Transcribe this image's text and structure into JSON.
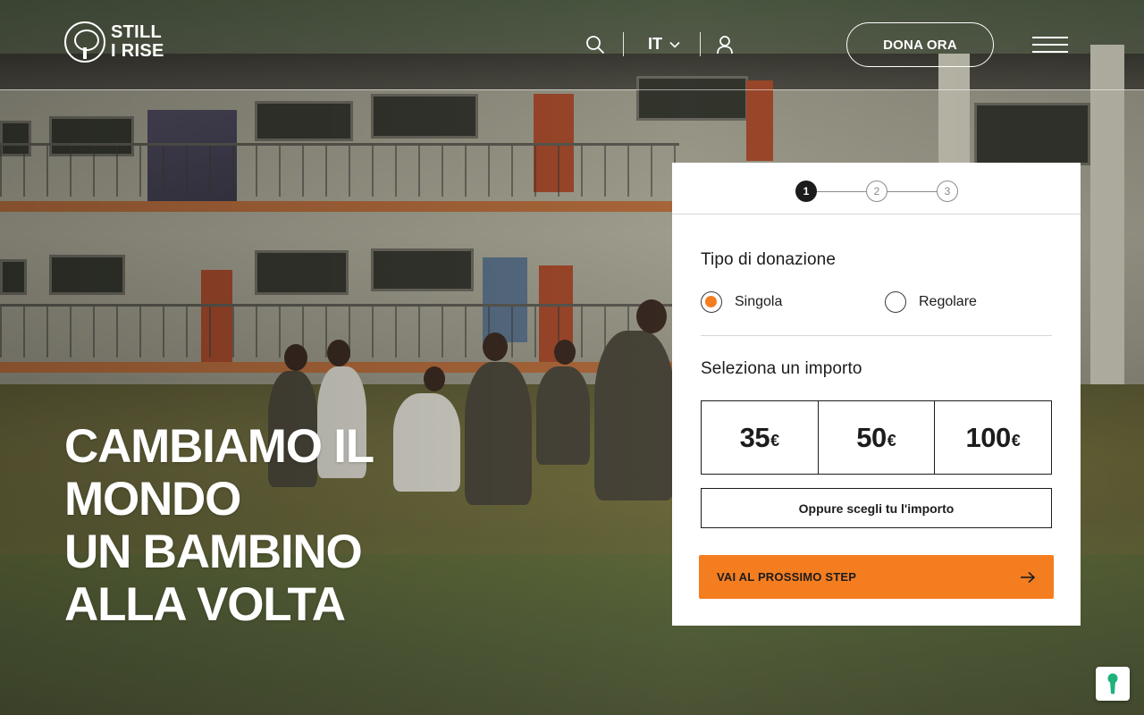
{
  "brand": {
    "name_line1": "STILL",
    "name_line2": "I RISE"
  },
  "header": {
    "language": "IT",
    "donate_label": "DONA ORA",
    "icons": [
      "search-icon",
      "chevron-down-icon",
      "user-icon",
      "hamburger-menu-icon"
    ]
  },
  "hero": {
    "headline": [
      "CAMBIAMO IL",
      "MONDO",
      "UN BAMBINO",
      "ALLA VOLTA"
    ]
  },
  "donation": {
    "steps": [
      "1",
      "2",
      "3"
    ],
    "active_step": "1",
    "type_title": "Tipo di donazione",
    "types": [
      {
        "label": "Singola",
        "selected": true
      },
      {
        "label": "Regolare",
        "selected": false
      }
    ],
    "amount_title": "Seleziona un importo",
    "amounts": [
      {
        "value": "35",
        "currency": "€"
      },
      {
        "value": "50",
        "currency": "€"
      },
      {
        "value": "100",
        "currency": "€"
      }
    ],
    "custom_label": "Oppure scegli tu l'importo",
    "next_label": "VAI AL PROSSIMO STEP"
  },
  "colors": {
    "accent": "#f47d20",
    "text_dark": "#1c1c1c",
    "white": "#ffffff"
  }
}
